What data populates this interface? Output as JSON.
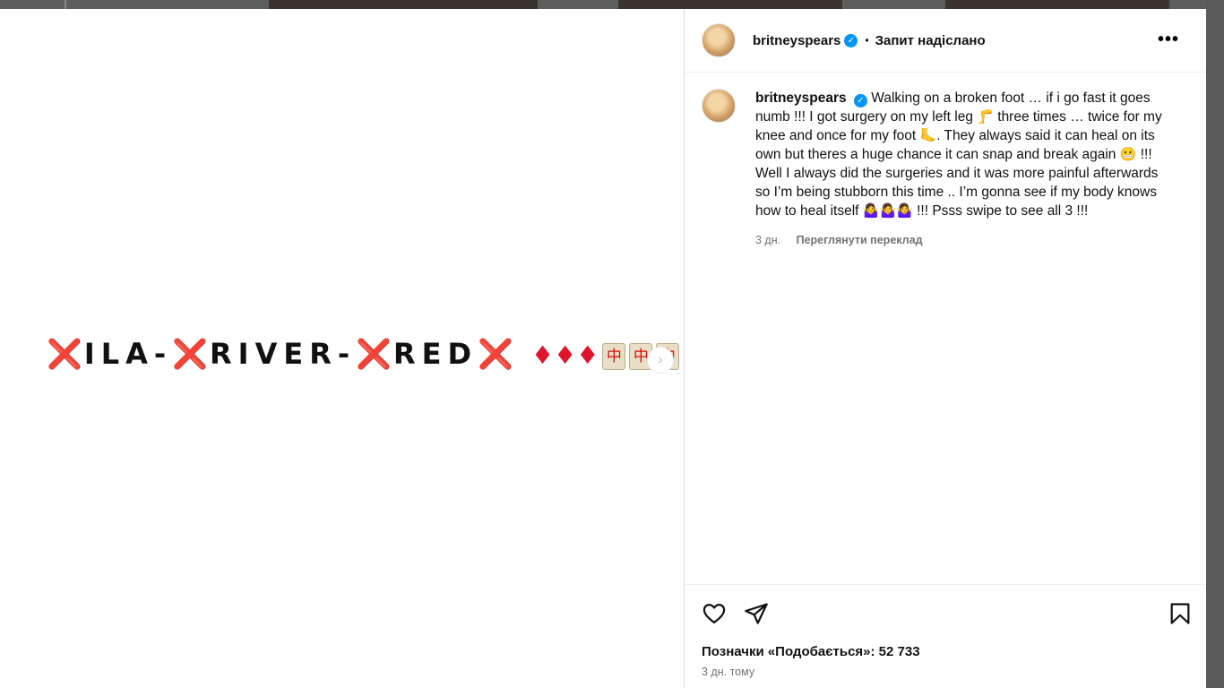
{
  "post": {
    "media_text": {
      "x": "❌",
      "part1": "ILA-",
      "part2": "RIVER-",
      "part3": "RED",
      "diamonds": "♦♦♦",
      "mahjong": "中"
    },
    "next_arrow": "›"
  },
  "header": {
    "username": "britneyspears",
    "verified_mark": "✓",
    "dot": "•",
    "follow_status": "Запит надіслано",
    "more": "•••"
  },
  "caption": {
    "username": "britneyspears",
    "verified_mark": "✓",
    "text_1": "Walking on a broken foot … if i go fast it goes numb !!! I got surgery on my left leg ",
    "emoji_leg": "🦵",
    "text_2": " three times … twice for my knee and once for my foot ",
    "emoji_foot": "🦶",
    "text_3": ". They always said it can heal on its own but theres a huge chance it can snap and break again ",
    "emoji_grimace": "😬",
    "text_4": " !!! Well I always did the surgeries and it was more painful afterwards so I’m being stubborn this time .. I’m gonna see if my body knows how to heal itself ",
    "emoji_shrug": "🤷‍♀️🤷‍♀️🤷‍♀️",
    "text_5": " !!! Psss swipe to see all 3 !!!",
    "age": "3 дн.",
    "see_translation": "Переглянути переклад"
  },
  "footer": {
    "likes": "Позначки «Подобається»: 52 733",
    "posted": "3 дн. тому"
  },
  "icons": [
    "heart-icon",
    "share-icon",
    "bookmark-icon",
    "more-icon",
    "chevron-right-icon",
    "verified-icon"
  ]
}
